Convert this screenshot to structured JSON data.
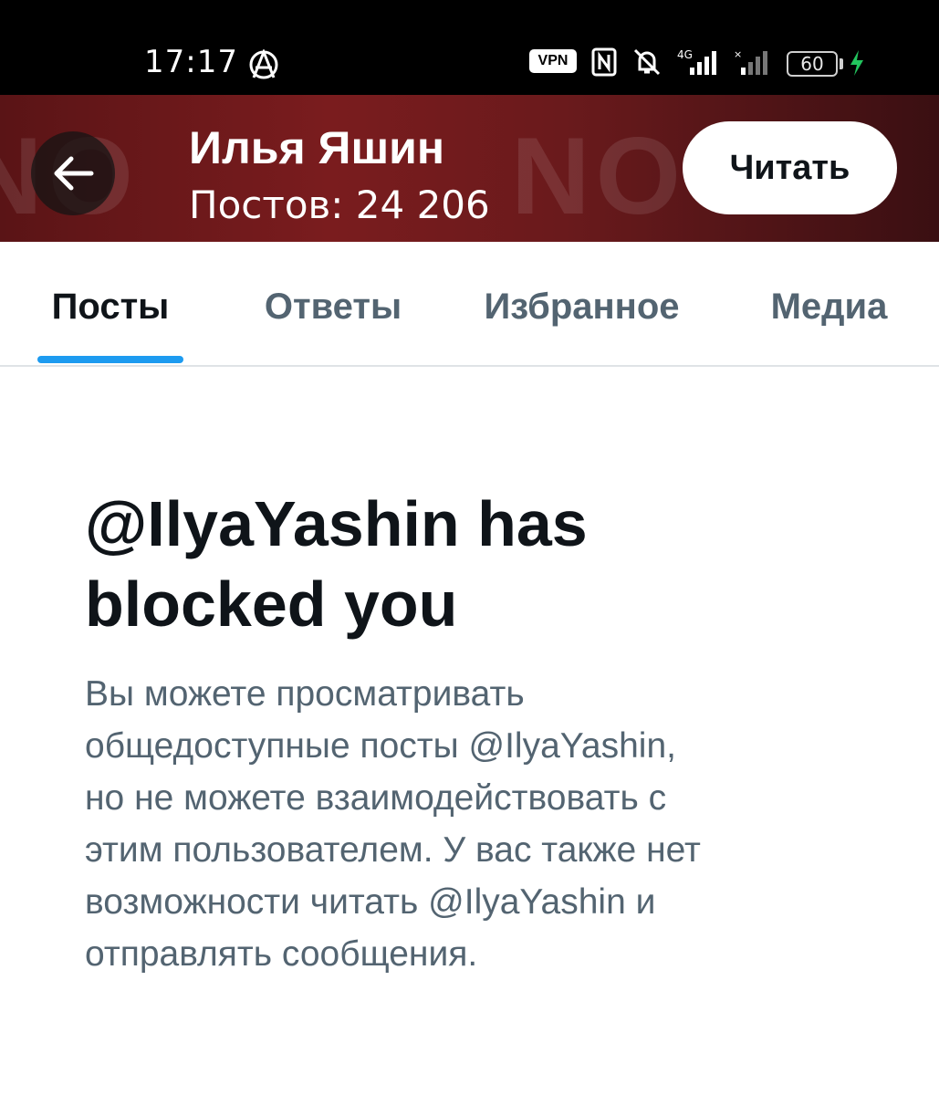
{
  "status_bar": {
    "time": "17:17",
    "vpn_label": "VPN",
    "network_label": "4G",
    "battery_percent": "60",
    "battery_level": 0.6,
    "icons": [
      "anarchy-icon",
      "nfc-icon",
      "mute-icon",
      "signal-icon",
      "battery-icon",
      "charging-icon"
    ]
  },
  "header": {
    "name": "Илья Яшин",
    "posts_count": "Постов: 24 206",
    "follow_label": "Читать",
    "colors": {
      "banner": "#6a1a1c",
      "button_bg": "#ffffff"
    }
  },
  "tabs": [
    {
      "label": "Посты",
      "active": true
    },
    {
      "label": "Ответы",
      "active": false
    },
    {
      "label": "Избранное",
      "active": false
    },
    {
      "label": "Медиа",
      "active": false
    }
  ],
  "blocked": {
    "title_line1": "@IlyaYashin has",
    "title_line2": "blocked you",
    "body_lines": [
      "Вы можете просматривать",
      "общедоступные посты @IlyaYashin,",
      "но не можете взаимодействовать с",
      "этим пользователем. У вас также нет",
      "возможности читать @IlyaYashin и",
      "отправлять сообщения."
    ]
  },
  "colors": {
    "accent": "#1d9bf0",
    "text_primary": "#0f1419",
    "text_secondary": "#536471"
  }
}
